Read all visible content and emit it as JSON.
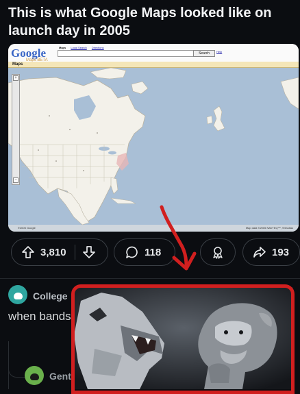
{
  "post": {
    "title": "This is what Google Maps looked like on launch day in 2005"
  },
  "map_screenshot": {
    "logo": "Google",
    "logo_sub": "Maps BETA",
    "links": [
      "Maps",
      "Local Search",
      "Directions"
    ],
    "search_button": "Search",
    "help_link": "Help",
    "bar_label": "Maps",
    "footer_left": "©2005 Google",
    "footer_right": "Map data ©2005 NAVTEQ™, TeleAtlas"
  },
  "actions": {
    "upvote_icon": "arrow-up-icon",
    "score": "3,810",
    "downvote_icon": "arrow-down-icon",
    "comments_icon": "comment-bubble-icon",
    "comments": "118",
    "award_icon": "award-icon",
    "share_icon": "share-arrow-icon",
    "shares": "193"
  },
  "comments": [
    {
      "user": "College",
      "text": "when bands",
      "avatar_color": "#2fa6a0"
    },
    {
      "user": "Gent",
      "avatar_color": "#6ab04c"
    }
  ],
  "colors": {
    "background": "#0b0d11",
    "annotation_red": "#d11f1f"
  }
}
